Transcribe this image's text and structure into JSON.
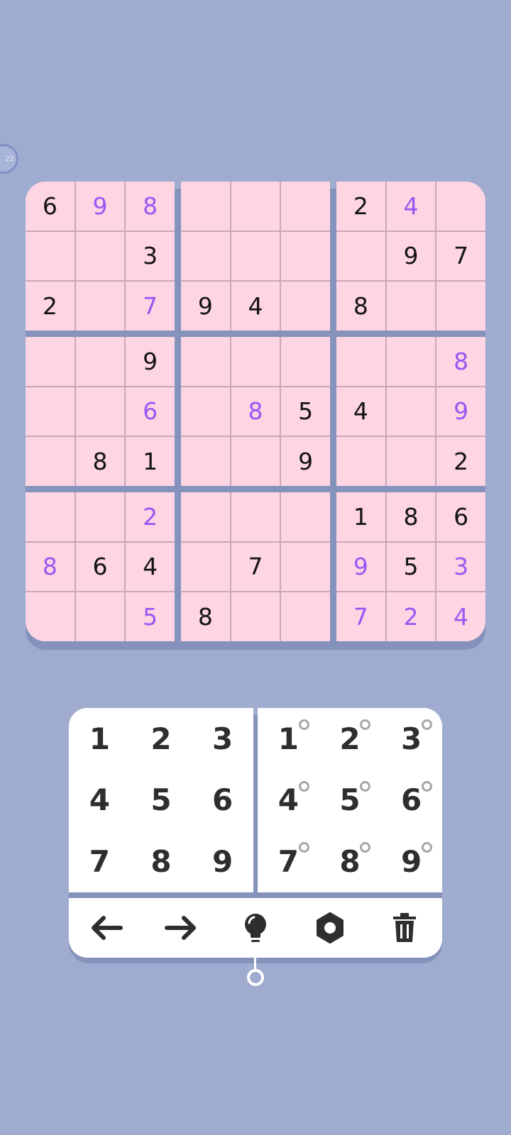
{
  "timer": {
    "label": "22"
  },
  "colors": {
    "background": "#9facd0",
    "cell": "#fed5e2",
    "given_digit": "#141414",
    "entered_digit": "#9a57f3"
  },
  "board": {
    "cells": [
      [
        {
          "v": "6",
          "t": "given"
        },
        {
          "v": "9",
          "t": "user"
        },
        {
          "v": "8",
          "t": "user"
        },
        {
          "v": "",
          "t": ""
        },
        {
          "v": "",
          "t": ""
        },
        {
          "v": "",
          "t": ""
        },
        {
          "v": "2",
          "t": "given"
        },
        {
          "v": "4",
          "t": "user"
        },
        {
          "v": "",
          "t": ""
        }
      ],
      [
        {
          "v": "",
          "t": ""
        },
        {
          "v": "",
          "t": ""
        },
        {
          "v": "3",
          "t": "given"
        },
        {
          "v": "",
          "t": ""
        },
        {
          "v": "",
          "t": ""
        },
        {
          "v": "",
          "t": ""
        },
        {
          "v": "",
          "t": ""
        },
        {
          "v": "9",
          "t": "given"
        },
        {
          "v": "7",
          "t": "given"
        }
      ],
      [
        {
          "v": "2",
          "t": "given"
        },
        {
          "v": "",
          "t": ""
        },
        {
          "v": "7",
          "t": "user"
        },
        {
          "v": "9",
          "t": "given"
        },
        {
          "v": "4",
          "t": "given"
        },
        {
          "v": "",
          "t": ""
        },
        {
          "v": "8",
          "t": "given"
        },
        {
          "v": "",
          "t": ""
        },
        {
          "v": "",
          "t": ""
        }
      ],
      [
        {
          "v": "",
          "t": ""
        },
        {
          "v": "",
          "t": ""
        },
        {
          "v": "9",
          "t": "given"
        },
        {
          "v": "",
          "t": ""
        },
        {
          "v": "",
          "t": ""
        },
        {
          "v": "",
          "t": ""
        },
        {
          "v": "",
          "t": ""
        },
        {
          "v": "",
          "t": ""
        },
        {
          "v": "8",
          "t": "user"
        }
      ],
      [
        {
          "v": "",
          "t": ""
        },
        {
          "v": "",
          "t": ""
        },
        {
          "v": "6",
          "t": "user"
        },
        {
          "v": "",
          "t": ""
        },
        {
          "v": "8",
          "t": "user"
        },
        {
          "v": "5",
          "t": "given"
        },
        {
          "v": "4",
          "t": "given"
        },
        {
          "v": "",
          "t": ""
        },
        {
          "v": "9",
          "t": "user"
        }
      ],
      [
        {
          "v": "",
          "t": ""
        },
        {
          "v": "8",
          "t": "given"
        },
        {
          "v": "1",
          "t": "given"
        },
        {
          "v": "",
          "t": ""
        },
        {
          "v": "",
          "t": ""
        },
        {
          "v": "9",
          "t": "given"
        },
        {
          "v": "",
          "t": ""
        },
        {
          "v": "",
          "t": ""
        },
        {
          "v": "2",
          "t": "given"
        }
      ],
      [
        {
          "v": "",
          "t": ""
        },
        {
          "v": "",
          "t": ""
        },
        {
          "v": "2",
          "t": "user"
        },
        {
          "v": "",
          "t": ""
        },
        {
          "v": "",
          "t": ""
        },
        {
          "v": "",
          "t": ""
        },
        {
          "v": "1",
          "t": "given"
        },
        {
          "v": "8",
          "t": "given"
        },
        {
          "v": "6",
          "t": "given"
        }
      ],
      [
        {
          "v": "8",
          "t": "user"
        },
        {
          "v": "6",
          "t": "given"
        },
        {
          "v": "4",
          "t": "given"
        },
        {
          "v": "",
          "t": ""
        },
        {
          "v": "7",
          "t": "given"
        },
        {
          "v": "",
          "t": ""
        },
        {
          "v": "9",
          "t": "user"
        },
        {
          "v": "5",
          "t": "given"
        },
        {
          "v": "3",
          "t": "user"
        }
      ],
      [
        {
          "v": "",
          "t": ""
        },
        {
          "v": "",
          "t": ""
        },
        {
          "v": "5",
          "t": "user"
        },
        {
          "v": "8",
          "t": "given"
        },
        {
          "v": "",
          "t": ""
        },
        {
          "v": "",
          "t": ""
        },
        {
          "v": "7",
          "t": "user"
        },
        {
          "v": "2",
          "t": "user"
        },
        {
          "v": "4",
          "t": "user"
        }
      ]
    ]
  },
  "keypad": {
    "digits": [
      "1",
      "2",
      "3",
      "4",
      "5",
      "6",
      "7",
      "8",
      "9"
    ],
    "note_digits": [
      "1",
      "2",
      "3",
      "4",
      "5",
      "6",
      "7",
      "8",
      "9"
    ]
  },
  "toolbar": {
    "icons": [
      "undo-arrow-icon",
      "redo-arrow-icon",
      "hint-bulb-icon",
      "settings-gear-icon",
      "trash-icon"
    ]
  }
}
